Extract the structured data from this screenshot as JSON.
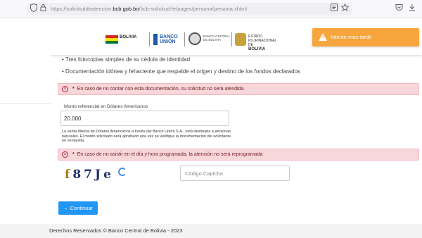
{
  "browser": {
    "url_prefix": "https://solicituddeatencion.",
    "url_domain": "bcb.gob.bo",
    "url_path": "/bcb-solicitud-fe/pages/persona/persona.xhtml",
    "icons": [
      "shield-icon",
      "lock-icon",
      "reader-icon",
      "star-icon",
      "pocket-icon",
      "download-icon"
    ]
  },
  "header": {
    "logos": {
      "bolivia": "BOLIVIA",
      "union": "BANCO UNIÓN",
      "bcb": "BANCO CENTRAL DE BOLIVIA",
      "estado_top": "ESTADO PLURINACIONAL DE",
      "estado": "BOLIVIA"
    }
  },
  "toast": {
    "message": "Intente mas tarde",
    "icon": "warning-icon",
    "color": "#f6a63d"
  },
  "requirements": [
    "Tres fotocopias simples de su cédula de identidad",
    "Documentación idónea y fehaciente que respalde el origen y destino de los fondos declarados"
  ],
  "alerts": {
    "documentation": "En caso de no contar con esta documentación, su solicitud no será atendida.",
    "schedule": "En caso de no asistir en el día y hora programada, la atención no será reprogramada",
    "asterisk": "*"
  },
  "form": {
    "amount_label": "Monto referencial en Dólares Americanos",
    "amount_value": "20.000",
    "note": "La venta directa de Dólares Americanos a través del Banco Unión S.A., está destinada a personas naturales. El monto solicitado será aprobado una vez se verifique la documentación del solicitante en ventanilla.",
    "captcha_chars": [
      "f",
      "8",
      "7",
      "J",
      "e"
    ],
    "captcha_placeholder": "Código Captcha",
    "submit_label": "Continuar"
  },
  "footer": {
    "text": "Derechos Reservados © Banco Central de Bolivia - 2023"
  },
  "colors": {
    "primary": "#2196f3",
    "danger_bg": "#f8d7da",
    "danger_text": "#721c24",
    "warning": "#f6a63d"
  }
}
